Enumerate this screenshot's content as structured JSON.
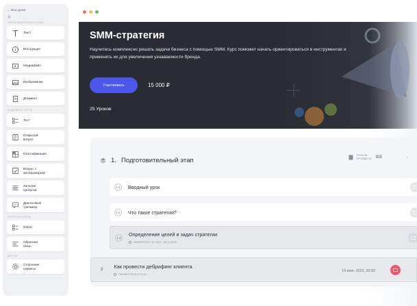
{
  "sidebar": {
    "back_label": "← Мои уроки",
    "sections": {
      "info_blocks": "ИНФОРМАЦИОННЫЕ БЛОКИ",
      "tasks": "ЗАДАНИЯ И ТЕСТЫ",
      "feedback": "ОБРАТНАЯ СВЯЗЬ",
      "other": "ДРУГОЕ"
    },
    "info_items": [
      {
        "label": "Текст",
        "icon": "text-icon"
      },
      {
        "label": "Инструкция",
        "icon": "info-icon"
      },
      {
        "label": "Медиафайл",
        "icon": "media-icon"
      },
      {
        "label": "Изображение",
        "icon": "image-icon"
      },
      {
        "label": "Документ",
        "icon": "document-icon"
      }
    ],
    "task_items": [
      {
        "label": "Тест",
        "icon": "test-icon"
      },
      {
        "label": "Открытый вопрос",
        "icon": "open-question-icon"
      },
      {
        "label": "Классификация",
        "icon": "classification-icon"
      },
      {
        "label": "Вопрос с автопроверкой",
        "icon": "autocheck-icon"
      },
      {
        "label": "Заполни пропуски",
        "icon": "fill-gaps-icon"
      },
      {
        "label": "Диалоговый тренажер",
        "icon": "dialog-icon"
      }
    ],
    "feedback_items": [
      {
        "label": "Опрос",
        "icon": "poll-icon"
      },
      {
        "label": "Обратная связь",
        "icon": "feedback-icon"
      }
    ],
    "other_items": [
      {
        "label": "Сторонние сервисы",
        "icon": "services-icon"
      }
    ]
  },
  "window": {
    "dots": [
      "#f26b5b",
      "#f5bd4f",
      "#5ec262"
    ]
  },
  "hero": {
    "title": "SMM-стратегия",
    "description": "Научитесь комплексно решать задачи бизнеса с помощью SMM. Курс поможет начать ориентироваться в инструментах и применять их для увеличения узнаваемости бренда.",
    "join_label": "Участвовать",
    "price": "15 000 ₽",
    "lessons_count": "25  Уроков"
  },
  "module": {
    "number": "1.",
    "title": "Подготовительный этап",
    "done_label_1": "УРОКОВ",
    "done_label_2": "ПРОЙДЕНО",
    "done_value": "0/3",
    "lessons": [
      {
        "num": "1.1",
        "title": "Вводный урок"
      },
      {
        "num": "1.2",
        "title": "Что такое стратегия?"
      },
      {
        "num": "1.3",
        "title": "Определение целей и задач стратегии",
        "starts": "НАЧНЕТСЯ 17.07.2022 - 30.11.2022"
      }
    ]
  },
  "module2": {
    "number": "2",
    "title": "Как провести дебрифинг клиента",
    "starts": "НАЧНЕТСЯ 19.07.2022",
    "date": "19 июл. 2022, 20:00"
  },
  "colors": {
    "accent": "#4a57e8",
    "hero_bg": "#2a2c33",
    "live_badge": "#e85a6b"
  }
}
